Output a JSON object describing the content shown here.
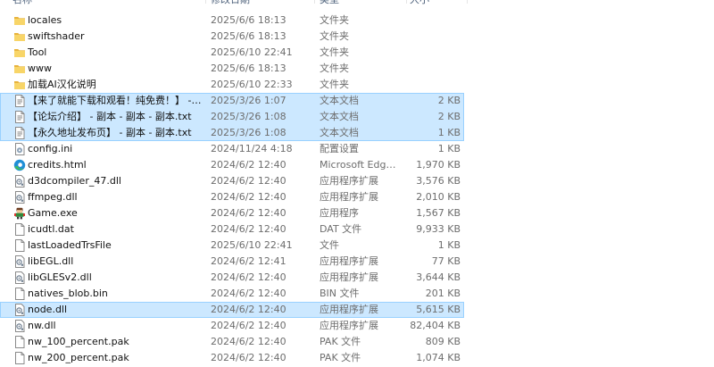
{
  "columns": {
    "name": "名称",
    "date": "修改日期",
    "type": "类型",
    "size": "大小"
  },
  "files": [
    {
      "name": "locales",
      "date": "2025/6/6 18:13",
      "type": "文件夹",
      "size": "",
      "icon": "folder-icon",
      "selected": false
    },
    {
      "name": "swiftshader",
      "date": "2025/6/6 18:13",
      "type": "文件夹",
      "size": "",
      "icon": "folder-icon",
      "selected": false
    },
    {
      "name": "Tool",
      "date": "2025/6/10 22:41",
      "type": "文件夹",
      "size": "",
      "icon": "folder-icon",
      "selected": false
    },
    {
      "name": "www",
      "date": "2025/6/6 18:13",
      "type": "文件夹",
      "size": "",
      "icon": "folder-icon",
      "selected": false
    },
    {
      "name": "加载AI汉化说明",
      "date": "2025/6/10 22:33",
      "type": "文件夹",
      "size": "",
      "icon": "folder-icon",
      "selected": false
    },
    {
      "name": "【来了就能下载和观看！纯免费！】 - 副...",
      "date": "2025/3/26 1:07",
      "type": "文本文档",
      "size": "2 KB",
      "icon": "text-document-icon",
      "selected": true
    },
    {
      "name": "【论坛介绍】 - 副本 - 副本 - 副本.txt",
      "date": "2025/3/26 1:08",
      "type": "文本文档",
      "size": "2 KB",
      "icon": "text-document-icon",
      "selected": true
    },
    {
      "name": "【永久地址发布页】 - 副本 - 副本.txt",
      "date": "2025/3/26 1:08",
      "type": "文本文档",
      "size": "1 KB",
      "icon": "text-document-icon",
      "selected": true
    },
    {
      "name": "config.ini",
      "date": "2024/11/24 4:18",
      "type": "配置设置",
      "size": "1 KB",
      "icon": "settings-file-icon",
      "selected": false
    },
    {
      "name": "credits.html",
      "date": "2024/6/2 12:40",
      "type": "Microsoft Edge ...",
      "size": "1,970 KB",
      "icon": "edge-icon",
      "selected": false
    },
    {
      "name": "d3dcompiler_47.dll",
      "date": "2024/6/2 12:40",
      "type": "应用程序扩展",
      "size": "3,576 KB",
      "icon": "dll-file-icon",
      "selected": false
    },
    {
      "name": "ffmpeg.dll",
      "date": "2024/6/2 12:40",
      "type": "应用程序扩展",
      "size": "2,010 KB",
      "icon": "dll-file-icon",
      "selected": false
    },
    {
      "name": "Game.exe",
      "date": "2024/6/2 12:40",
      "type": "应用程序",
      "size": "1,567 KB",
      "icon": "game-exe-icon",
      "selected": false
    },
    {
      "name": "icudtl.dat",
      "date": "2024/6/2 12:40",
      "type": "DAT 文件",
      "size": "9,933 KB",
      "icon": "blank-file-icon",
      "selected": false
    },
    {
      "name": "lastLoadedTrsFile",
      "date": "2025/6/10 22:41",
      "type": "文件",
      "size": "1 KB",
      "icon": "blank-file-icon",
      "selected": false
    },
    {
      "name": "libEGL.dll",
      "date": "2024/6/2 12:41",
      "type": "应用程序扩展",
      "size": "77 KB",
      "icon": "dll-file-icon",
      "selected": false
    },
    {
      "name": "libGLESv2.dll",
      "date": "2024/6/2 12:40",
      "type": "应用程序扩展",
      "size": "3,644 KB",
      "icon": "dll-file-icon",
      "selected": false
    },
    {
      "name": "natives_blob.bin",
      "date": "2024/6/2 12:40",
      "type": "BIN 文件",
      "size": "201 KB",
      "icon": "blank-file-icon",
      "selected": false
    },
    {
      "name": "node.dll",
      "date": "2024/6/2 12:40",
      "type": "应用程序扩展",
      "size": "5,615 KB",
      "icon": "dll-file-icon",
      "selected": true
    },
    {
      "name": "nw.dll",
      "date": "2024/6/2 12:40",
      "type": "应用程序扩展",
      "size": "82,404 KB",
      "icon": "dll-file-icon",
      "selected": false
    },
    {
      "name": "nw_100_percent.pak",
      "date": "2024/6/2 12:40",
      "type": "PAK 文件",
      "size": "809 KB",
      "icon": "blank-file-icon",
      "selected": false
    },
    {
      "name": "nw_200_percent.pak",
      "date": "2024/6/2 12:40",
      "type": "PAK 文件",
      "size": "1,074 KB",
      "icon": "blank-file-icon",
      "selected": false
    }
  ],
  "colors": {
    "selection": "#cce8ff",
    "selection_border": "#99d1ff",
    "folder": "#f8d568",
    "text_muted": "#6d6d6d"
  }
}
